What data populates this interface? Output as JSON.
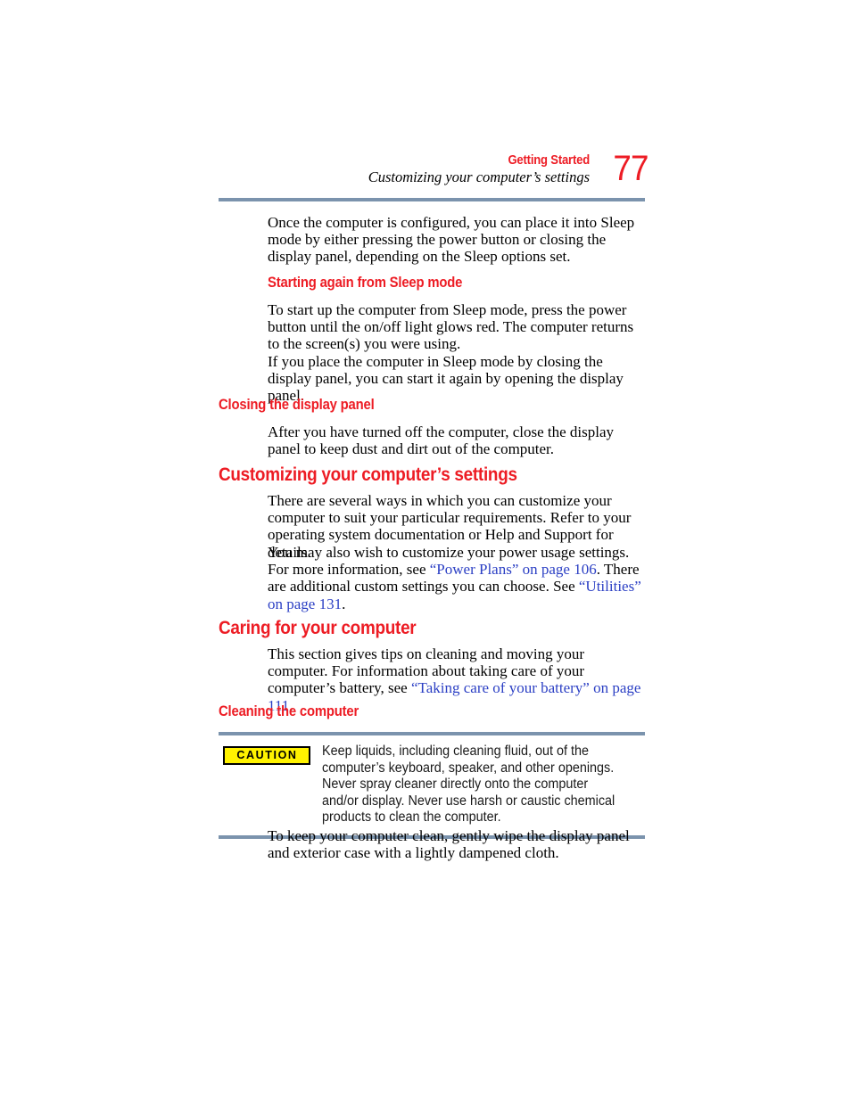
{
  "header": {
    "chapter": "Getting Started",
    "section": "Customizing your computer’s settings",
    "page_number": "77",
    "rule_color": "#7B93AD"
  },
  "colors": {
    "heading_red": "#ED1C24",
    "link_blue": "#2B3FC4",
    "rule_blue_gray": "#7B93AD",
    "caution_yellow": "#FFF200"
  },
  "body": {
    "intro_paragraph": "Once the computer is configured, you can place it into Sleep mode by either pressing the power button or closing the display panel, depending on the Sleep options set.",
    "heading_starting_again": "Starting again from Sleep mode",
    "starting_again_p1": "To start up the computer from Sleep mode, press the power button until the on/off light glows red. The computer returns to the screen(s) you were using.",
    "starting_again_p2": "If you place the computer in Sleep mode by closing the display panel, you can start it again by opening the display panel.",
    "heading_closing_panel": "Closing the display panel",
    "closing_panel_p1": "After you have turned off the computer, close the display panel to keep dust and dirt out of the computer.",
    "heading_customizing": "Customizing your computer’s settings",
    "customizing_p1": "There are several ways in which you can customize your computer to suit your particular requirements. Refer to your operating system documentation or Help and Support for details.",
    "customizing_p2": {
      "part1": "You may also wish to customize your power usage settings. For more information, see ",
      "link1": "“Power Plans” on page 106",
      "part2": ". There are additional custom settings you can choose. See ",
      "link2": "“Utilities” on page 131",
      "part3": "."
    },
    "heading_caring": "Caring for your computer",
    "caring_p1": {
      "part1": "This section gives tips on cleaning and moving your computer. For information about taking care of your computer’s battery, see ",
      "link1": "“Taking care of your battery” on page 111",
      "part2": "."
    },
    "heading_cleaning": "Cleaning the computer",
    "caution": {
      "badge_label": "CAUTION",
      "text": "Keep liquids, including cleaning fluid, out of the computer’s keyboard, speaker, and other openings. Never spray cleaner directly onto the computer and/or display. Never use harsh or caustic chemical products to clean the computer."
    },
    "cleaning_p1": "To keep your computer clean, gently wipe the display panel and exterior case with a lightly dampened cloth."
  }
}
